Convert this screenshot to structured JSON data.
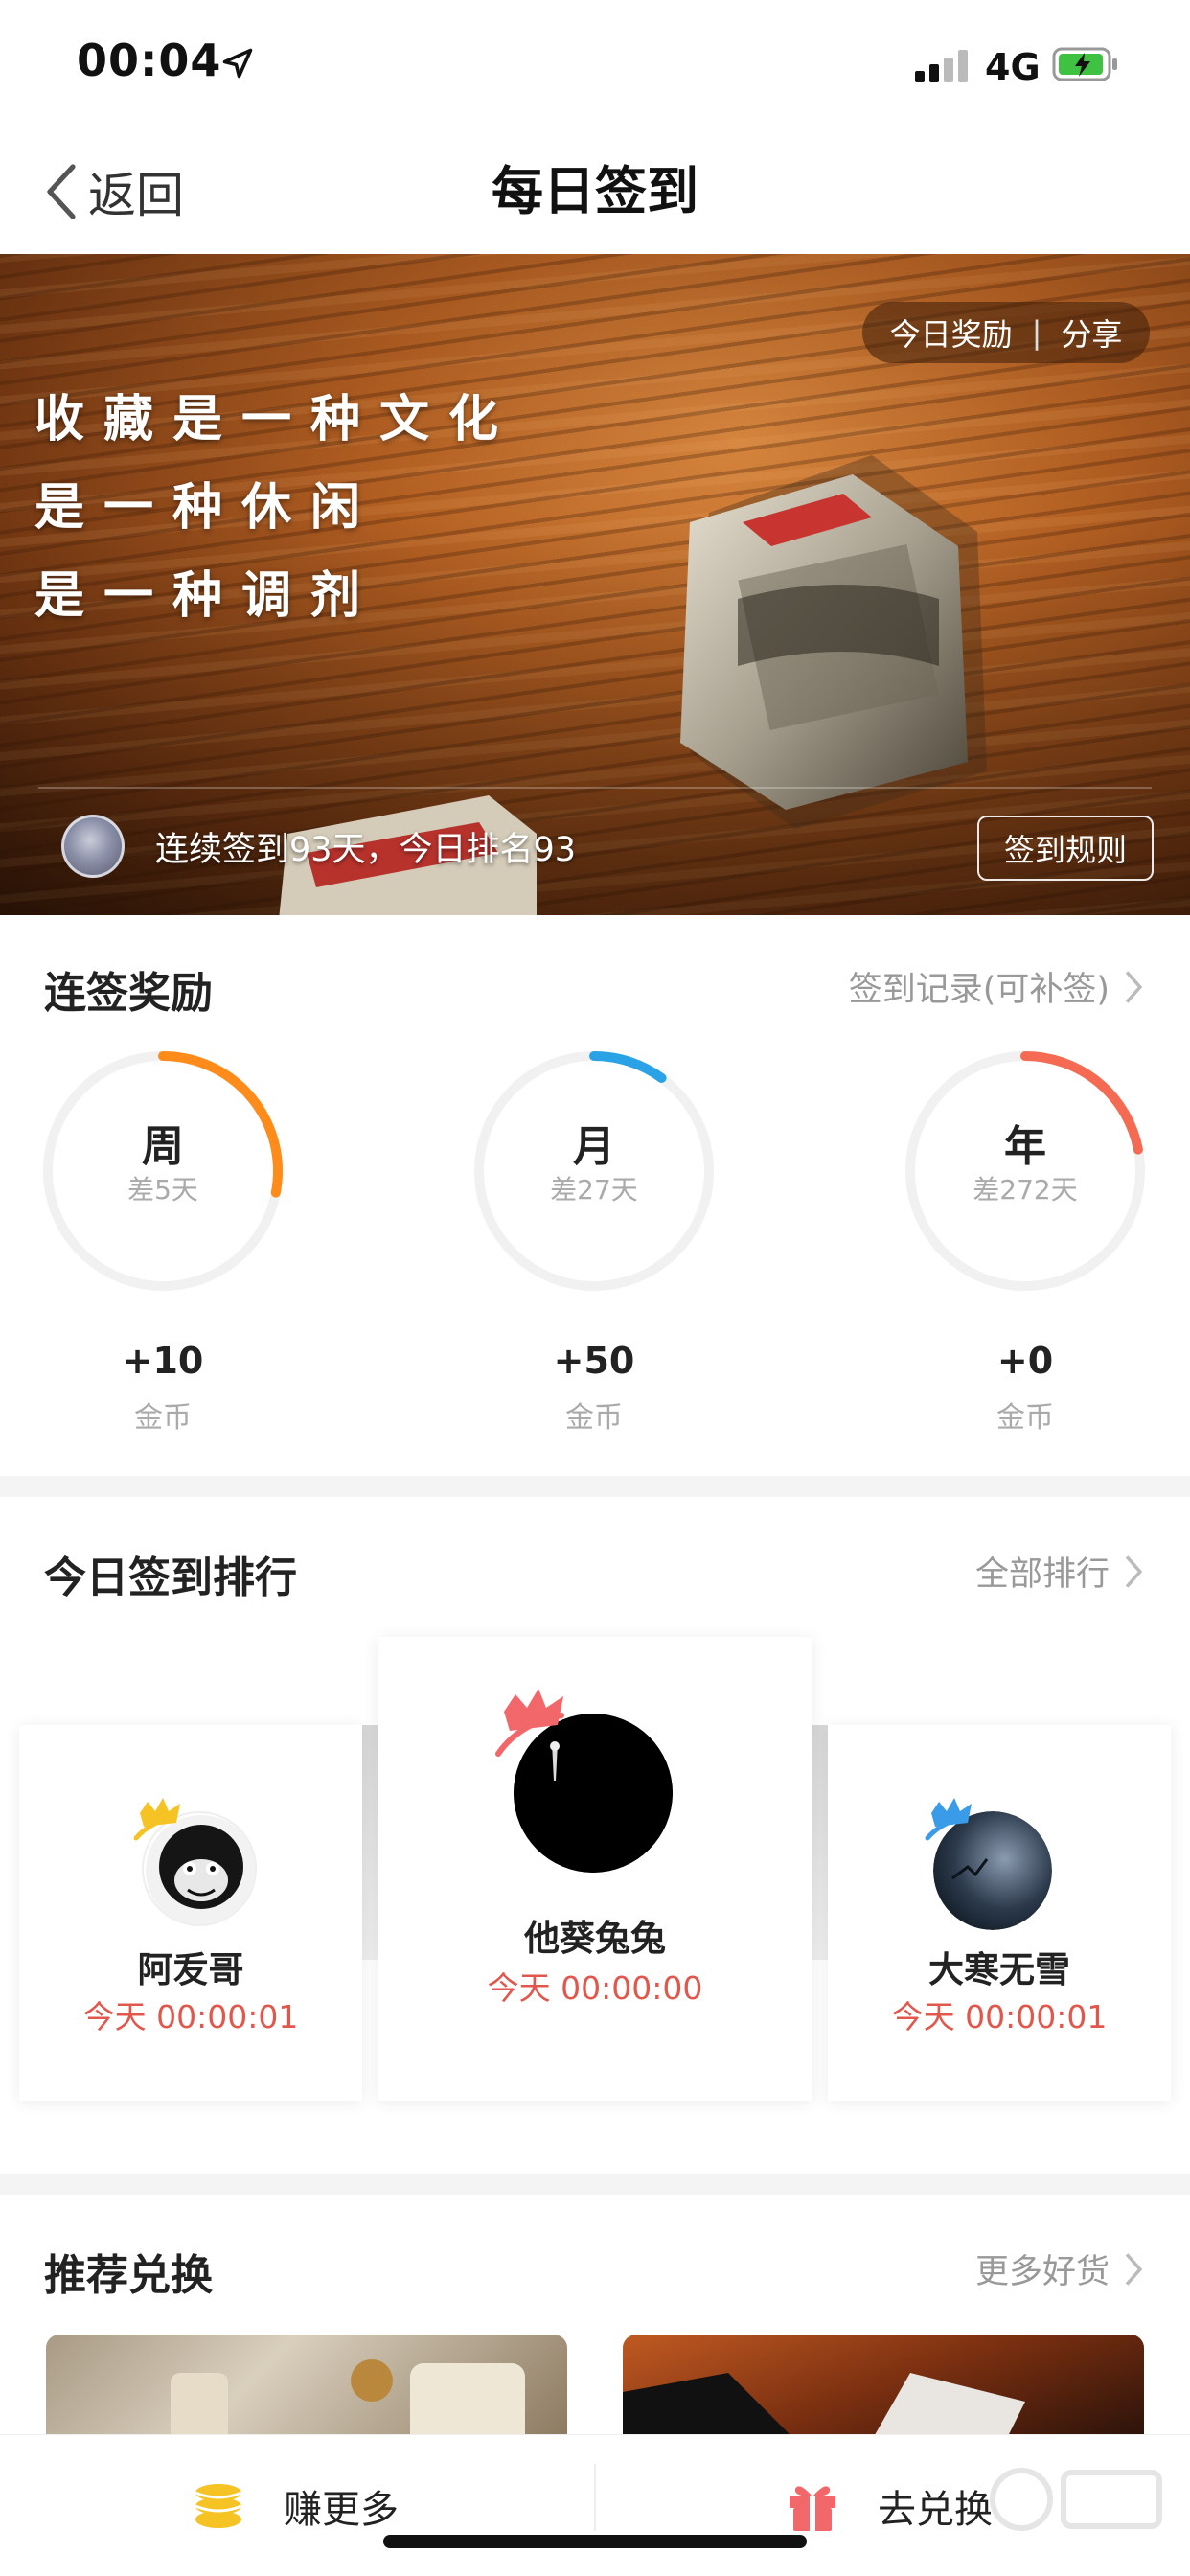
{
  "status_bar": {
    "time": "00:04",
    "network": "4G",
    "icons": [
      "location-arrow-icon",
      "signal-icon",
      "battery-charging-icon"
    ]
  },
  "nav": {
    "back_label": "返回",
    "title": "每日签到"
  },
  "banner": {
    "actions": {
      "reward": "今日奖励",
      "separator": "|",
      "share": "分享"
    },
    "slogan": [
      "收藏是一种文化",
      "是一种休闲",
      "是一种调剂"
    ],
    "status_text": "连续签到93天，今日排名93",
    "rules_button": "签到规则"
  },
  "rewards": {
    "title": "连签奖励",
    "link": "签到记录(可补签)",
    "items": [
      {
        "label": "周",
        "remaining": "差5天",
        "value": "+10",
        "unit": "金币",
        "progress": 0.28,
        "color": "#ff8c1a"
      },
      {
        "label": "月",
        "remaining": "差27天",
        "value": "+50",
        "unit": "金币",
        "progress": 0.1,
        "color": "#29a3e6"
      },
      {
        "label": "年",
        "remaining": "差272天",
        "value": "+0",
        "unit": "金币",
        "progress": 0.22,
        "color": "#f46a52"
      }
    ]
  },
  "ranking": {
    "title": "今日签到排行",
    "link": "全部排行",
    "entries": [
      {
        "name": "阿叐哥",
        "time": "今天 00:00:01",
        "crown_color": "#f6c324"
      },
      {
        "name": "他葵兔兔",
        "time": "今天 00:00:00",
        "crown_color": "#f2676a"
      },
      {
        "name": "大寒无雪",
        "time": "今天 00:00:01",
        "crown_color": "#3a9be8"
      }
    ]
  },
  "recommend": {
    "title": "推荐兑换",
    "link": "更多好货"
  },
  "bottom_bar": {
    "earn_label": "赚更多",
    "exchange_label": "去兑换"
  },
  "colors": {
    "accent_red": "#e2574c",
    "gold": "#f6c324"
  }
}
